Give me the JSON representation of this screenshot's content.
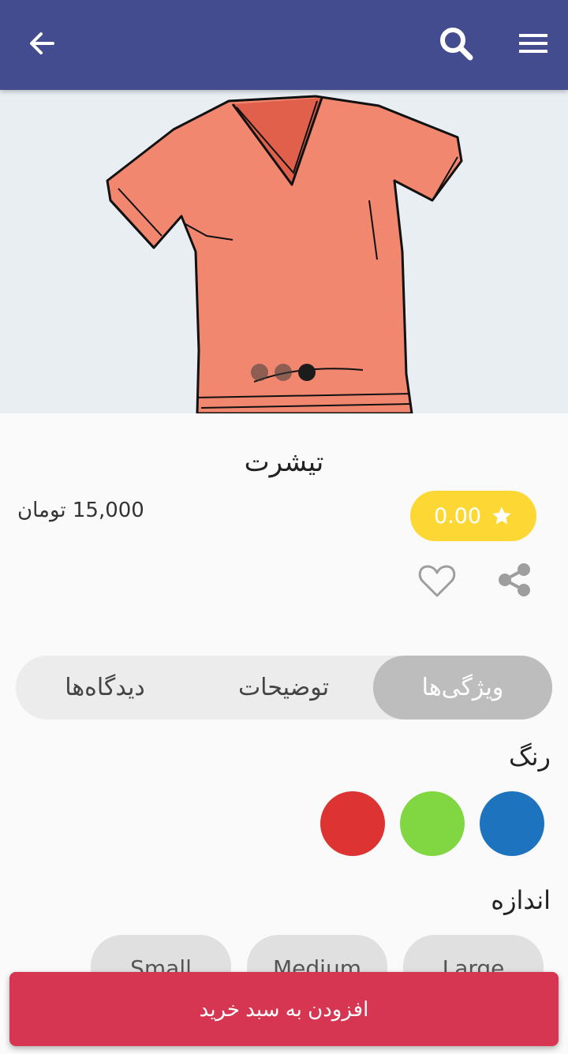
{
  "appbar": {
    "back_icon": "arrow-left-icon",
    "search_icon": "search-icon",
    "menu_icon": "hamburger-menu-icon",
    "color": "#434c8f"
  },
  "gallery": {
    "image": "orange-tshirt-illustration",
    "dots": 3,
    "active_dot": 3
  },
  "product": {
    "title": "تیشرت",
    "price": "15,000 تومان",
    "rating": "0.00",
    "rating_icon": "star-icon",
    "wishlist_icon": "heart-outline-icon",
    "share_icon": "share-icon"
  },
  "tabs": [
    {
      "label": "ویژگی‌ها",
      "active": true
    },
    {
      "label": "توضیحات",
      "active": false
    },
    {
      "label": "دیدگاه‌ها",
      "active": false
    }
  ],
  "attributes": {
    "color_label": "رنگ",
    "colors": [
      "#1e73be",
      "#81d742",
      "#dd3333"
    ],
    "size_label": "اندازه",
    "sizes": [
      "Large",
      "Medium",
      "Small"
    ]
  },
  "cta": {
    "label": "افزودن به سبد خرید",
    "color": "#d63651"
  }
}
